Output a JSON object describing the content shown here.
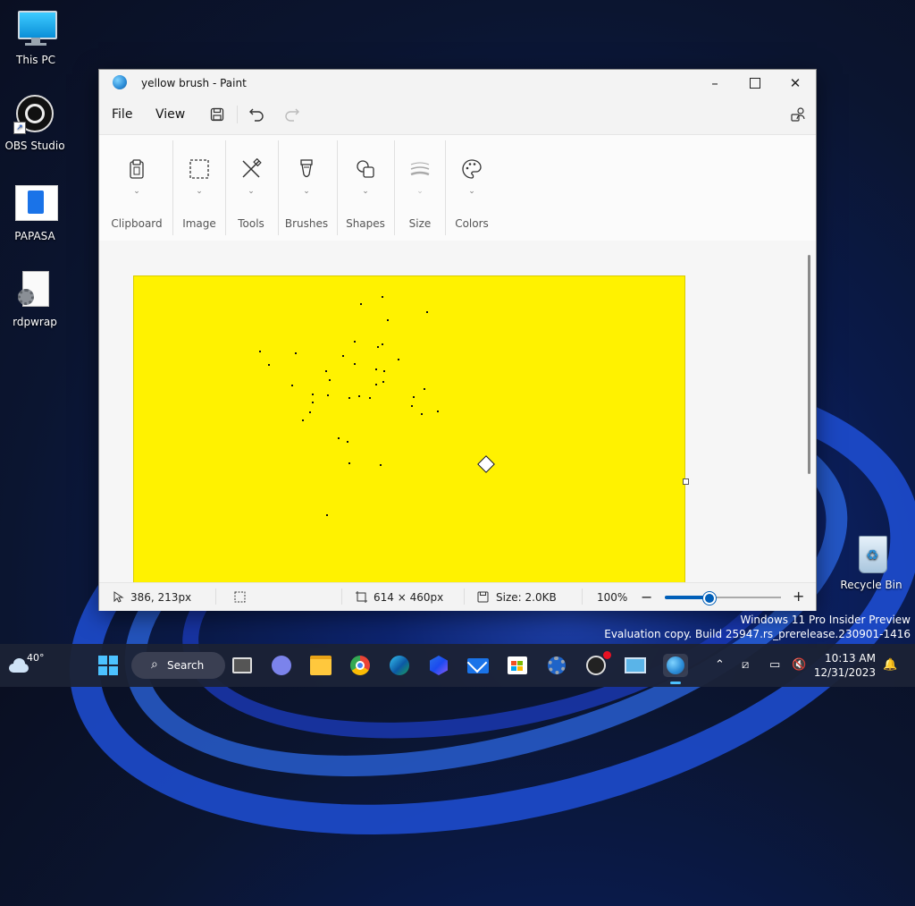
{
  "desktop": {
    "icons": [
      {
        "label": "This PC"
      },
      {
        "label": "OBS Studio"
      },
      {
        "label": "PAPASA"
      },
      {
        "label": "rdpwrap"
      },
      {
        "label": "Recycle Bin"
      }
    ],
    "watermark": {
      "line1": "Windows 11 Pro Insider Preview",
      "line2": "Evaluation copy. Build 25947.rs_prerelease.230901-1416"
    }
  },
  "window": {
    "title": "yellow brush - Paint",
    "menu": {
      "file": "File",
      "view": "View"
    },
    "ribbon": {
      "groups": [
        {
          "label": "Clipboard",
          "icon": "clipboard-icon"
        },
        {
          "label": "Image",
          "icon": "selection-icon"
        },
        {
          "label": "Tools",
          "icon": "tools-icon"
        },
        {
          "label": "Brushes",
          "icon": "brush-icon"
        },
        {
          "label": "Shapes",
          "icon": "shapes-icon"
        },
        {
          "label": "Size",
          "icon": "size-icon"
        },
        {
          "label": "Colors",
          "icon": "palette-icon"
        }
      ]
    },
    "canvas": {
      "color": "#fff200"
    },
    "status": {
      "cursor_pos": "386, 213px",
      "canvas_size": "614 × 460px",
      "file_size": "Size: 2.0KB",
      "zoom": "100%",
      "zoom_fraction": 0.37
    }
  },
  "taskbar": {
    "weather_temp": "40°",
    "search_label": "Search",
    "time": "10:13 AM",
    "date": "12/31/2023"
  }
}
